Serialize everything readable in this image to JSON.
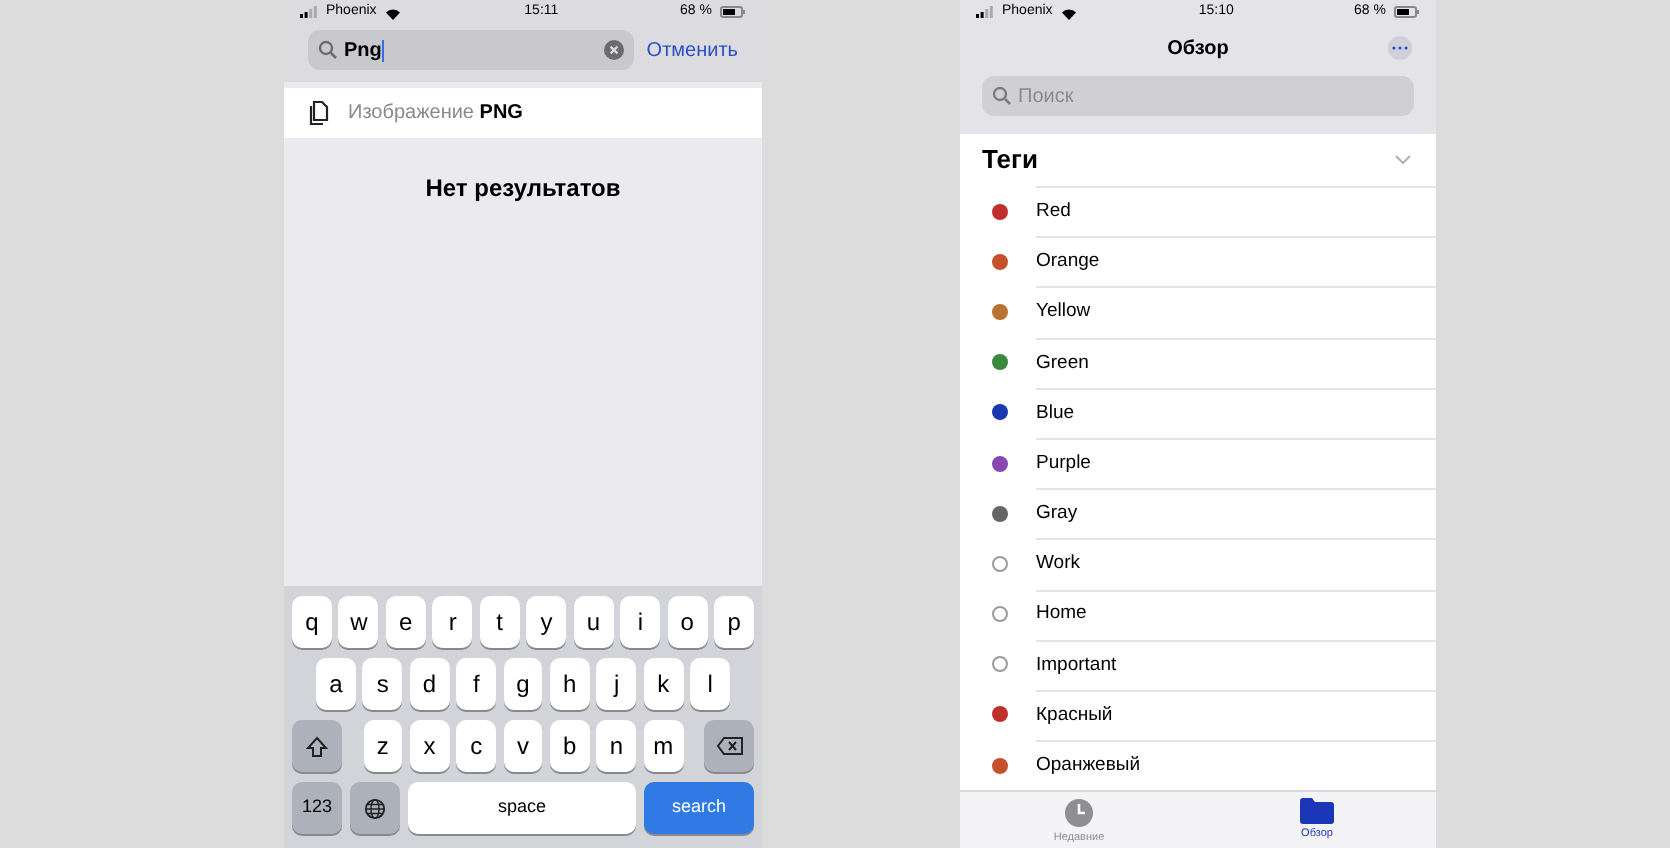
{
  "left_phone": {
    "status_bar": {
      "carrier": "Phoenix",
      "time": "15:11",
      "battery": "68 %"
    },
    "search": {
      "value": "Png",
      "cancel": "Отменить"
    },
    "suggestion": {
      "text": "Изображение **PNG**"
    },
    "empty_message": "Нет результатов",
    "keyboard": {
      "rows": [
        [
          "q",
          "w",
          "e",
          "r",
          "t",
          "y",
          "u",
          "i",
          "o",
          "p"
        ],
        [
          "a",
          "s",
          "d",
          "f",
          "g",
          "h",
          "j",
          "k",
          "l"
        ],
        [
          "z",
          "x",
          "c",
          "v",
          "b",
          "n",
          "m"
        ]
      ],
      "bottom": [
        {
          "kind": "numbers",
          "label": "123"
        },
        {
          "kind": "globe"
        },
        {
          "kind": "space",
          "label": "space"
        },
        {
          "kind": "action",
          "label": "search"
        }
      ]
    }
  },
  "right_phone": {
    "status_bar": {
      "carrier": "Phoenix",
      "time": "15:10",
      "battery": "68 %"
    },
    "title": "Обзор",
    "search": {
      "placeholder": "Поиск"
    },
    "section": {
      "title": "Теги",
      "expanded": true
    },
    "tags": [
      {
        "name": "Red",
        "kind": "dot",
        "color": "#c0302a"
      },
      {
        "name": "Orange",
        "kind": "dot",
        "color": "#c4502c"
      },
      {
        "name": "Yellow",
        "kind": "dot",
        "color": "#b87330"
      },
      {
        "name": "Green",
        "kind": "dot",
        "color": "#3a8a3e"
      },
      {
        "name": "Blue",
        "kind": "dot",
        "color": "#1c38b0"
      },
      {
        "name": "Purple",
        "kind": "dot",
        "color": "#8848b0"
      },
      {
        "name": "Gray",
        "kind": "dot",
        "color": "#666666"
      },
      {
        "name": "Work",
        "kind": "ring"
      },
      {
        "name": "Home",
        "kind": "ring"
      },
      {
        "name": "Important",
        "kind": "ring"
      },
      {
        "name": "Красный",
        "kind": "dot",
        "color": "#c0302a"
      },
      {
        "name": "Оранжевый",
        "kind": "dot",
        "color": "#c4502c"
      }
    ],
    "tab_bar": [
      {
        "label": "Недавние",
        "kind": "recents",
        "selected": false
      },
      {
        "label": "Обзор",
        "kind": "browse",
        "selected": true
      }
    ]
  }
}
